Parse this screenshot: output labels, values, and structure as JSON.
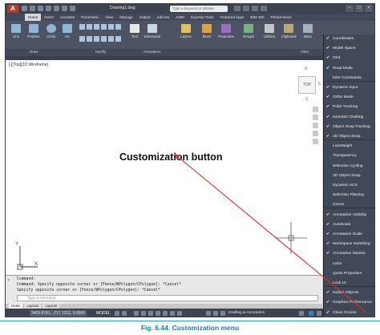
{
  "title_bar": {
    "document_title": "Drawing1.dwg",
    "search_placeholder": "Type a keyword or phrase"
  },
  "ribbon": {
    "tabs": [
      "Home",
      "Insert",
      "Annotate",
      "Parametric",
      "View",
      "Manage",
      "Output",
      "Add-ins",
      "A360",
      "Express Tools",
      "Featured Apps",
      "BIM 360",
      "Performance"
    ],
    "active_tab": "Home",
    "buttons": [
      "Line",
      "Polyline",
      "Circle",
      "Arc",
      "Text",
      "Dimension",
      "Layers",
      "Block",
      "Properties",
      "Groups",
      "Utilities",
      "Clipboard",
      "Base"
    ],
    "panels": [
      "Draw",
      "Modify",
      "Annotation",
      "View"
    ]
  },
  "viewport": {
    "label": "[-][Top][2D Wireframe]",
    "viewcube_face": "TOP",
    "compass": {
      "n": "N",
      "e": "E",
      "s": "S"
    },
    "ucs_x": "X",
    "ucs_y": "Y"
  },
  "callout": {
    "text": "Customization button"
  },
  "command_line": {
    "history": [
      "Command:",
      "Command: Specify opposite corner or [Fence/WPolygon/CPolygon]: *Cancel*",
      "Specify opposite corner or [Fence/WPolygon/CPolygon]: *Cancel*"
    ],
    "prompt_placeholder": "Type a command"
  },
  "layout_tabs": [
    "Model",
    "Layout1",
    "Layout2"
  ],
  "status_bar": {
    "coordinates": "3409.8781, -217.1312, 0.0000",
    "model_label": "MODEL",
    "workspace": "Drafting & Annotation"
  },
  "customization_menu": {
    "items": [
      {
        "label": "Coordinates",
        "checked": true
      },
      {
        "label": "Model Space",
        "checked": true
      },
      {
        "label": "Grid",
        "checked": true
      },
      {
        "label": "Snap Mode",
        "checked": true
      },
      {
        "label": "Infer Constraints",
        "checked": false
      },
      {
        "label": "Dynamic Input",
        "checked": true
      },
      {
        "label": "Ortho Mode",
        "checked": true
      },
      {
        "label": "Polar Tracking",
        "checked": true
      },
      {
        "label": "Isometric Drafting",
        "checked": true
      },
      {
        "label": "Object Snap Tracking",
        "checked": true
      },
      {
        "label": "2D Object Snap",
        "checked": true
      },
      {
        "label": "LineWeight",
        "checked": false
      },
      {
        "label": "Transparency",
        "checked": false
      },
      {
        "label": "Selection Cycling",
        "checked": false
      },
      {
        "label": "3D Object Snap",
        "checked": false
      },
      {
        "label": "Dynamic UCS",
        "checked": false
      },
      {
        "label": "Selection Filtering",
        "checked": false
      },
      {
        "label": "Gizmo",
        "checked": false
      },
      {
        "label": "Annotation Visibility",
        "checked": true
      },
      {
        "label": "AutoScale",
        "checked": true
      },
      {
        "label": "Annotation Scale",
        "checked": true
      },
      {
        "label": "Workspace Switching",
        "checked": true
      },
      {
        "label": "Annotation Monitor",
        "checked": true
      },
      {
        "label": "Units",
        "checked": false
      },
      {
        "label": "Quick Properties",
        "checked": false
      },
      {
        "label": "Lock UI",
        "checked": false
      },
      {
        "label": "Isolate Objects",
        "checked": true
      },
      {
        "label": "Graphics Performance",
        "checked": true
      },
      {
        "label": "Clean Screen",
        "checked": true
      }
    ]
  },
  "caption": {
    "label": "Fig. 6.44.",
    "text": "Customization menu"
  },
  "colors": {
    "arrow": "#d9302c",
    "caption": "#1a7fa8",
    "menu_bg": "#414856"
  }
}
